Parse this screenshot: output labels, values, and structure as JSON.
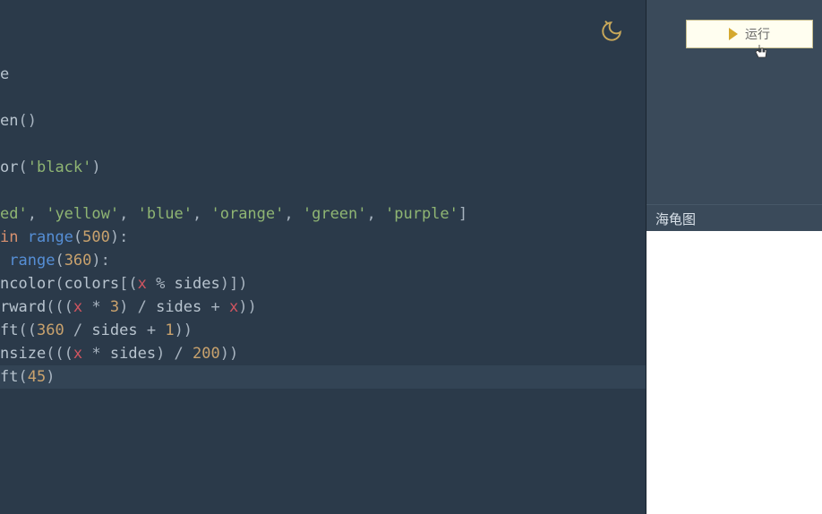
{
  "editor": {
    "theme_icon": "moon-icon",
    "code_lines": [
      {
        "tokens": [
          {
            "t": "e",
            "c": "tok-default"
          }
        ]
      },
      {
        "tokens": []
      },
      {
        "tokens": [
          {
            "t": "en",
            "c": "tok-func"
          },
          {
            "t": "()",
            "c": "tok-punct"
          }
        ]
      },
      {
        "tokens": []
      },
      {
        "tokens": [
          {
            "t": "or",
            "c": "tok-func"
          },
          {
            "t": "(",
            "c": "tok-punct"
          },
          {
            "t": "'black'",
            "c": "tok-string"
          },
          {
            "t": ")",
            "c": "tok-punct"
          }
        ]
      },
      {
        "tokens": []
      },
      {
        "tokens": [
          {
            "t": "ed'",
            "c": "tok-string"
          },
          {
            "t": ", ",
            "c": "tok-punct"
          },
          {
            "t": "'yellow'",
            "c": "tok-string"
          },
          {
            "t": ", ",
            "c": "tok-punct"
          },
          {
            "t": "'blue'",
            "c": "tok-string"
          },
          {
            "t": ", ",
            "c": "tok-punct"
          },
          {
            "t": "'orange'",
            "c": "tok-string"
          },
          {
            "t": ", ",
            "c": "tok-punct"
          },
          {
            "t": "'green'",
            "c": "tok-string"
          },
          {
            "t": ", ",
            "c": "tok-punct"
          },
          {
            "t": "'purple'",
            "c": "tok-string"
          },
          {
            "t": "]",
            "c": "tok-punct"
          }
        ]
      },
      {
        "tokens": [
          {
            "t": "in",
            "c": "tok-keyword"
          },
          {
            "t": " ",
            "c": "tok-default"
          },
          {
            "t": "range",
            "c": "tok-builtin"
          },
          {
            "t": "(",
            "c": "tok-punct"
          },
          {
            "t": "500",
            "c": "tok-number"
          },
          {
            "t": "):",
            "c": "tok-punct"
          }
        ]
      },
      {
        "tokens": [
          {
            "t": " ",
            "c": "tok-default"
          },
          {
            "t": "range",
            "c": "tok-builtin"
          },
          {
            "t": "(",
            "c": "tok-punct"
          },
          {
            "t": "360",
            "c": "tok-number"
          },
          {
            "t": "):",
            "c": "tok-punct"
          }
        ]
      },
      {
        "tokens": [
          {
            "t": "ncolor",
            "c": "tok-func"
          },
          {
            "t": "(",
            "c": "tok-punct"
          },
          {
            "t": "colors",
            "c": "tok-default"
          },
          {
            "t": "[(",
            "c": "tok-punct"
          },
          {
            "t": "x",
            "c": "tok-var"
          },
          {
            "t": " % ",
            "c": "tok-punct"
          },
          {
            "t": "sides",
            "c": "tok-default"
          },
          {
            "t": ")])",
            "c": "tok-punct"
          }
        ]
      },
      {
        "tokens": [
          {
            "t": "rward",
            "c": "tok-func"
          },
          {
            "t": "(((",
            "c": "tok-punct"
          },
          {
            "t": "x",
            "c": "tok-var"
          },
          {
            "t": " * ",
            "c": "tok-punct"
          },
          {
            "t": "3",
            "c": "tok-number"
          },
          {
            "t": ") / ",
            "c": "tok-punct"
          },
          {
            "t": "sides",
            "c": "tok-default"
          },
          {
            "t": " + ",
            "c": "tok-punct"
          },
          {
            "t": "x",
            "c": "tok-var"
          },
          {
            "t": "))",
            "c": "tok-punct"
          }
        ]
      },
      {
        "tokens": [
          {
            "t": "ft",
            "c": "tok-func"
          },
          {
            "t": "((",
            "c": "tok-punct"
          },
          {
            "t": "360",
            "c": "tok-number"
          },
          {
            "t": " / ",
            "c": "tok-punct"
          },
          {
            "t": "sides",
            "c": "tok-default"
          },
          {
            "t": " + ",
            "c": "tok-punct"
          },
          {
            "t": "1",
            "c": "tok-number"
          },
          {
            "t": "))",
            "c": "tok-punct"
          }
        ]
      },
      {
        "tokens": [
          {
            "t": "nsize",
            "c": "tok-func"
          },
          {
            "t": "(((",
            "c": "tok-punct"
          },
          {
            "t": "x",
            "c": "tok-var"
          },
          {
            "t": " * ",
            "c": "tok-punct"
          },
          {
            "t": "sides",
            "c": "tok-default"
          },
          {
            "t": ") / ",
            "c": "tok-punct"
          },
          {
            "t": "200",
            "c": "tok-number"
          },
          {
            "t": "))",
            "c": "tok-punct"
          }
        ]
      },
      {
        "tokens": [
          {
            "t": "ft",
            "c": "tok-func"
          },
          {
            "t": "(",
            "c": "tok-punct"
          },
          {
            "t": "45",
            "c": "tok-number"
          },
          {
            "t": ")",
            "c": "tok-punct"
          }
        ],
        "highlighted": true,
        "has_cursor": true
      }
    ]
  },
  "right": {
    "run_button_label": "运行",
    "output_header": "海龟图"
  }
}
